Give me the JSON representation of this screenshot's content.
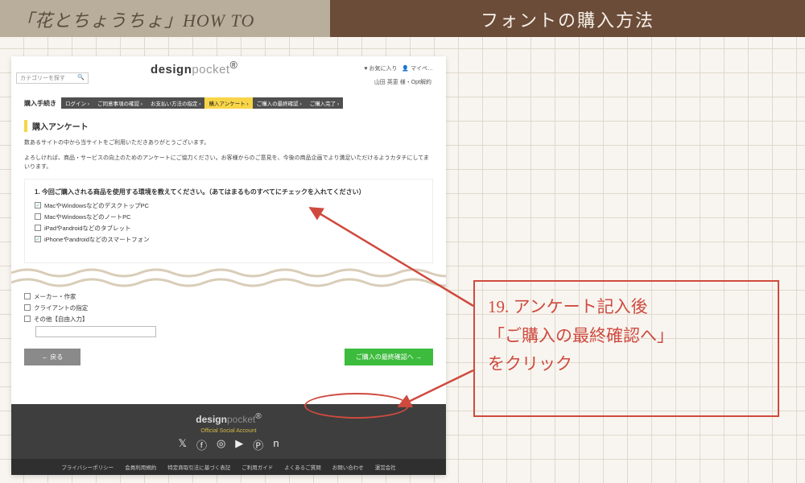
{
  "header": {
    "left": "「花とちょうちょ」HOW TO",
    "right": "フォントの購入方法"
  },
  "screenshot": {
    "top_links": {
      "fav": "♥ お気に入り",
      "mypage": "👤 マイペ…"
    },
    "search_placeholder": "カテゴリーを探す",
    "logo_a": "design",
    "logo_b": "pocket",
    "logo_mark": "®",
    "user_line": "山田 英恵 様・Opt解約",
    "step_label": "購入手続き",
    "steps": [
      "ログイン",
      "ご同意事項の確認",
      "お支払い方法の指定",
      "購入アンケート",
      "ご購入の最終確認",
      "ご購入完了"
    ],
    "active_step_index": 3,
    "h2": "購入アンケート",
    "intro_1": "数あるサイトの中から当サイトをご利用いただきありがとうございます。",
    "intro_2": "よろしければ、商品・サービスの向上のためのアンケートにご協力ください。お客様からのご意見を、今後の商品企画でより満足いただけるようカタチにしてまいります。",
    "q1": "1. 今回ご購入される商品を使用する環境を教えてください。（あてはまるものすべてにチェックを入れてください）",
    "q1_options": [
      {
        "label": "MacやWindowsなどのデスクトップPC",
        "checked": true
      },
      {
        "label": "MacやWindowsなどのノートPC",
        "checked": false
      },
      {
        "label": "iPadやandroidなどのタブレット",
        "checked": false
      },
      {
        "label": "iPhoneやandroidなどのスマートフォン",
        "checked": true
      }
    ],
    "q_extra_options": [
      {
        "label": "メーカー・作家",
        "checked": false
      },
      {
        "label": "クライアントの指定",
        "checked": false
      },
      {
        "label": "その他【自由入力】",
        "checked": false
      }
    ],
    "back_btn": "← 戻る",
    "next_btn": "ご購入の最終確認へ →",
    "footer": {
      "social_label": "Official Social Account",
      "icons": [
        "x-icon",
        "facebook-icon",
        "instagram-icon",
        "youtube-icon",
        "pinterest-icon",
        "note-icon"
      ],
      "links": [
        "プライバシーポリシー",
        "会員利用規約",
        "特定商取引法に基づく表記",
        "ご利用ガイド",
        "よくあるご質問",
        "お問い合わせ",
        "運営会社"
      ]
    }
  },
  "callout": {
    "line1": "19. アンケート記入後",
    "line2": "「ご購入の最終確認へ」",
    "line3": "をクリック"
  }
}
